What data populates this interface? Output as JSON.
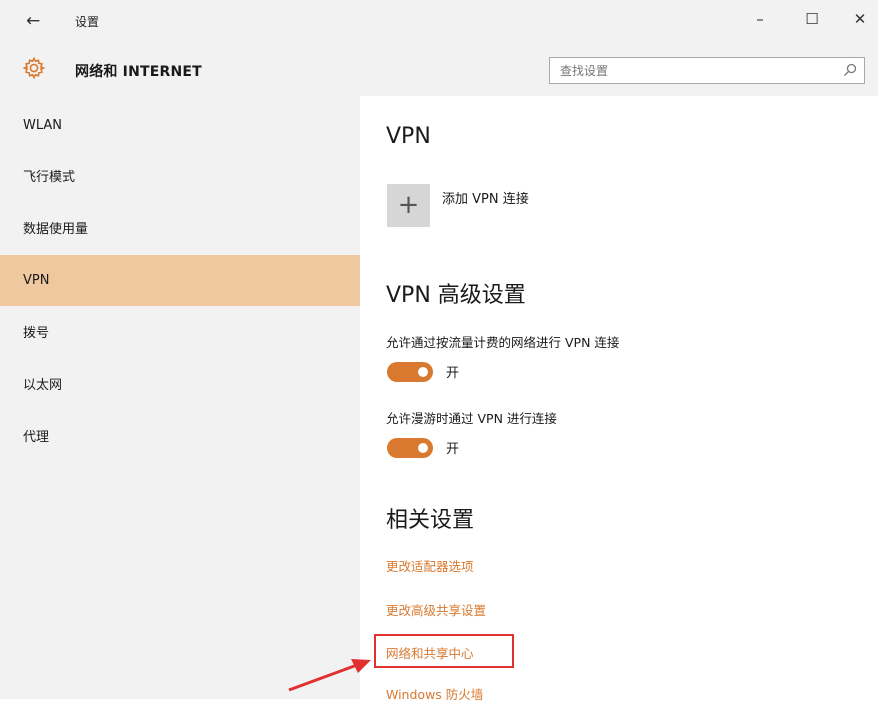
{
  "window": {
    "title": "设置",
    "back_icon": "back-arrow-icon",
    "minimize_glyph": "–",
    "maximize_glyph": "☐",
    "close_glyph": "✕"
  },
  "header": {
    "section_title": "网络和 INTERNET",
    "icon": "gear-icon",
    "search_placeholder": "查找设置",
    "search_value": ""
  },
  "sidebar": {
    "items": [
      {
        "label": "WLAN",
        "selected": false
      },
      {
        "label": "飞行模式",
        "selected": false
      },
      {
        "label": "数据使用量",
        "selected": false
      },
      {
        "label": "VPN",
        "selected": true
      },
      {
        "label": "拨号",
        "selected": false
      },
      {
        "label": "以太网",
        "selected": false
      },
      {
        "label": "代理",
        "selected": false
      }
    ]
  },
  "main": {
    "vpn_heading": "VPN",
    "add_vpn": {
      "icon_glyph": "+",
      "label": "添加 VPN 连接"
    },
    "advanced_heading": "VPN 高级设置",
    "options": [
      {
        "label": "允许通过按流量计费的网络进行 VPN 连接",
        "state_label": "开",
        "on": true
      },
      {
        "label": "允许漫游时通过 VPN 进行连接",
        "state_label": "开",
        "on": true
      }
    ],
    "related_heading": "相关设置",
    "related_links": [
      {
        "label": "更改适配器选项"
      },
      {
        "label": "更改高级共享设置"
      },
      {
        "label": "网络和共享中心",
        "highlighted": true
      },
      {
        "label": "Windows 防火墙"
      }
    ]
  },
  "colors": {
    "accent": "#d9792f",
    "selected_nav": "#f0c8a0",
    "sidebar_bg": "#f2f2f2",
    "annotation_red": "#e03030"
  }
}
